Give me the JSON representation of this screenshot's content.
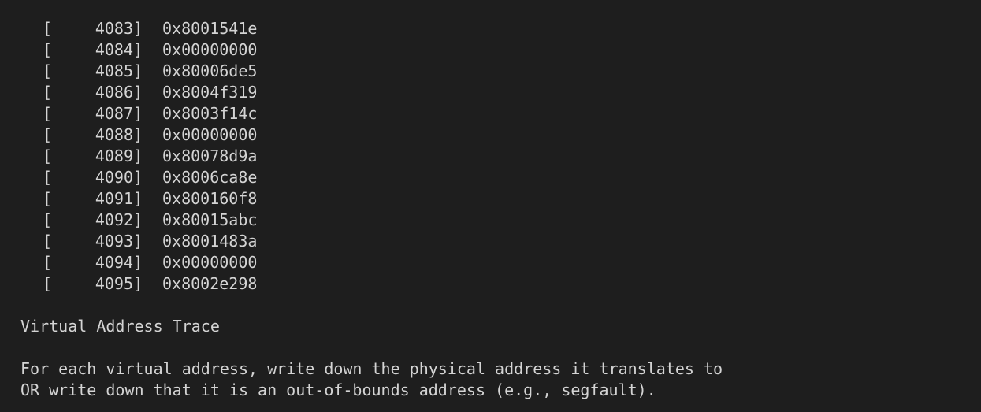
{
  "table": {
    "rows": [
      {
        "open": "[",
        "index": "4083",
        "close": "]",
        "value": "0x8001541e"
      },
      {
        "open": "[",
        "index": "4084",
        "close": "]",
        "value": "0x00000000"
      },
      {
        "open": "[",
        "index": "4085",
        "close": "]",
        "value": "0x80006de5"
      },
      {
        "open": "[",
        "index": "4086",
        "close": "]",
        "value": "0x8004f319"
      },
      {
        "open": "[",
        "index": "4087",
        "close": "]",
        "value": "0x8003f14c"
      },
      {
        "open": "[",
        "index": "4088",
        "close": "]",
        "value": "0x00000000"
      },
      {
        "open": "[",
        "index": "4089",
        "close": "]",
        "value": "0x80078d9a"
      },
      {
        "open": "[",
        "index": "4090",
        "close": "]",
        "value": "0x8006ca8e"
      },
      {
        "open": "[",
        "index": "4091",
        "close": "]",
        "value": "0x800160f8"
      },
      {
        "open": "[",
        "index": "4092",
        "close": "]",
        "value": "0x80015abc"
      },
      {
        "open": "[",
        "index": "4093",
        "close": "]",
        "value": "0x8001483a"
      },
      {
        "open": "[",
        "index": "4094",
        "close": "]",
        "value": "0x00000000"
      },
      {
        "open": "[",
        "index": "4095",
        "close": "]",
        "value": "0x8002e298"
      }
    ]
  },
  "section": {
    "title": "Virtual Address Trace",
    "lines": [
      "For each virtual address, write down the physical address it translates to",
      "OR write down that it is an out-of-bounds address (e.g., segfault)."
    ]
  },
  "colors": {
    "background": "#1e1e1e",
    "text": "#d4d4d4"
  }
}
